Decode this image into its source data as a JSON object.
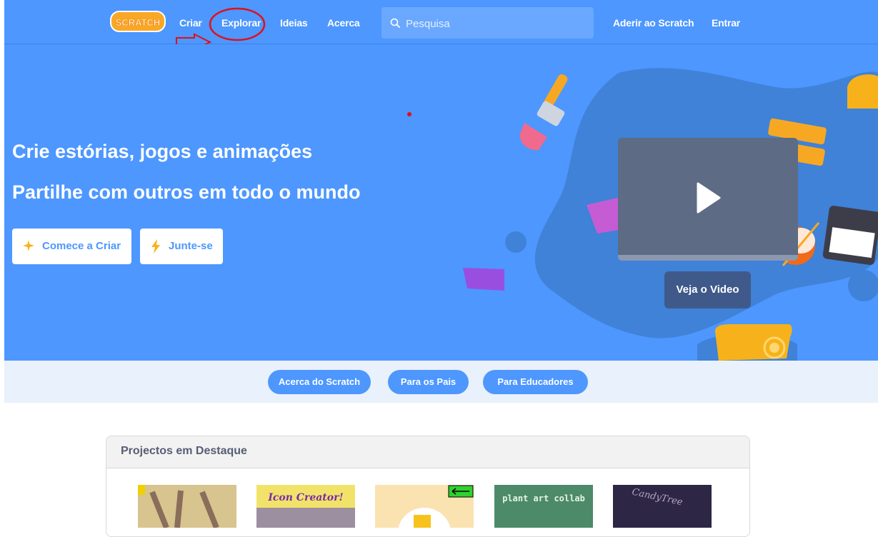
{
  "nav": {
    "logo_text": "SCRATCH",
    "links": [
      "Criar",
      "Explorar",
      "Ideias",
      "Acerca"
    ],
    "search_placeholder": "Pesquisa",
    "join_label": "Aderir ao Scratch",
    "signin_label": "Entrar"
  },
  "hero": {
    "title_line1": "Crie estórias, jogos e animações",
    "title_line2": "Partilhe com outros em todo o mundo",
    "start_button": "Comece a Criar",
    "join_button": "Junte-se",
    "watch_video": "Veja o Video"
  },
  "subnav": {
    "links": [
      "Acerca do Scratch",
      "Para os Pais",
      "Para Educadores"
    ]
  },
  "featured": {
    "title": "Projectos em Destaque",
    "thumb_texts": [
      "Icon Creator!",
      "plant art collab",
      "CandyTree"
    ]
  },
  "colors": {
    "scratch_blue": "#4d97ff",
    "annotation_red": "#e0101a"
  }
}
